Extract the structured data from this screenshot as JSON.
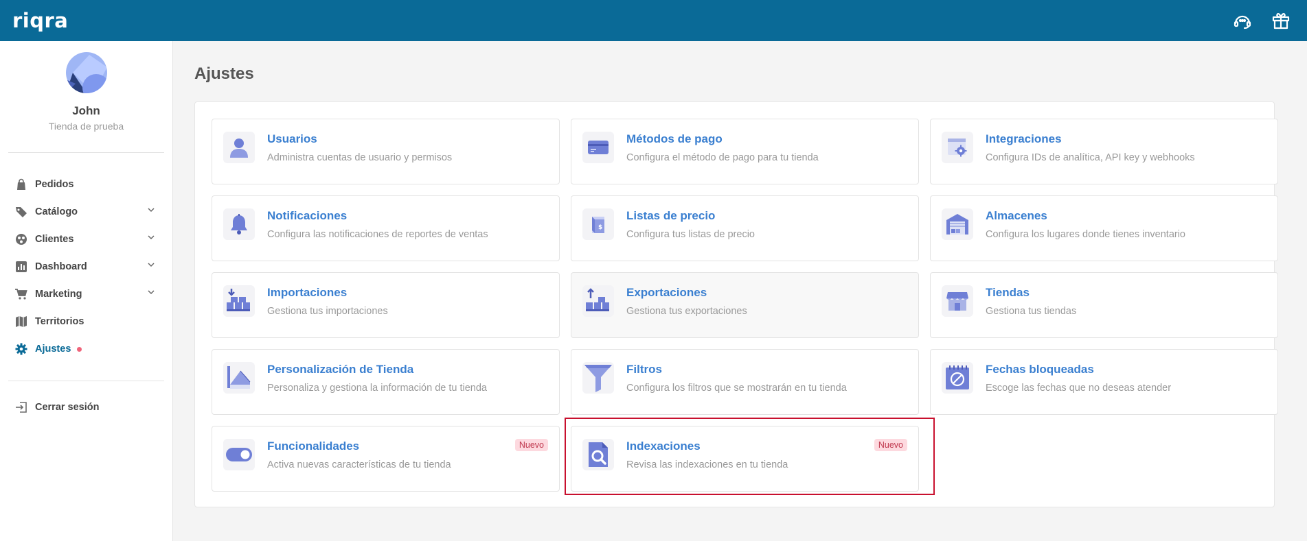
{
  "header": {
    "logo": "riqra",
    "icons": [
      "support-icon",
      "gift-icon"
    ]
  },
  "profile": {
    "name": "John",
    "store": "Tienda de prueba"
  },
  "nav": {
    "items": [
      {
        "label": "Pedidos",
        "icon": "bag-icon"
      },
      {
        "label": "Catálogo",
        "icon": "tag-icon"
      },
      {
        "label": "Clientes",
        "icon": "users-icon"
      },
      {
        "label": "Dashboard",
        "icon": "chart-icon"
      },
      {
        "label": "Marketing",
        "icon": "cart-icon"
      },
      {
        "label": "Territorios",
        "icon": "map-icon"
      },
      {
        "label": "Ajustes",
        "icon": "gear-icon"
      }
    ],
    "logout": "Cerrar sesión"
  },
  "page": {
    "title": "Ajustes"
  },
  "cards": [
    {
      "title": "Usuarios",
      "desc": "Administra cuentas de usuario y permisos",
      "icon": "user-icon"
    },
    {
      "title": "Métodos de pago",
      "desc": "Configura el método de pago para tu tienda",
      "icon": "credit-card-icon"
    },
    {
      "title": "Integraciones",
      "desc": "Configura IDs de analítica, API key y webhooks",
      "icon": "integration-gear-icon"
    },
    {
      "title": "Notificaciones",
      "desc": "Configura las notificaciones de reportes de ventas",
      "icon": "bell-icon"
    },
    {
      "title": "Listas de precio",
      "desc": "Configura tus listas de precio",
      "icon": "price-list-icon"
    },
    {
      "title": "Almacenes",
      "desc": "Configura los lugares donde tienes inventario",
      "icon": "warehouse-icon"
    },
    {
      "title": "Importaciones",
      "desc": "Gestiona tus importaciones",
      "icon": "import-icon"
    },
    {
      "title": "Exportaciones",
      "desc": "Gestiona tus exportaciones",
      "icon": "export-icon"
    },
    {
      "title": "Tiendas",
      "desc": "Gestiona tus tiendas",
      "icon": "store-icon"
    },
    {
      "title": "Personalización de Tienda",
      "desc": "Personaliza y gestiona la información de tu tienda",
      "icon": "customize-icon"
    },
    {
      "title": "Filtros",
      "desc": "Configura los filtros que se mostrarán en tu tienda",
      "icon": "funnel-icon"
    },
    {
      "title": "Fechas bloqueadas",
      "desc": "Escoge las fechas que no deseas atender",
      "icon": "blocked-calendar-icon"
    },
    {
      "title": "Funcionalidades",
      "desc": "Activa nuevas características de tu tienda",
      "icon": "toggle-icon",
      "badge": "Nuevo"
    },
    {
      "title": "Indexaciones",
      "desc": "Revisa las indexaciones en tu tienda",
      "icon": "search-document-icon",
      "badge": "Nuevo"
    }
  ],
  "colors": {
    "header": "#0a6a97",
    "link": "#3a7fd0",
    "icon": "#6f7fd6",
    "badge_bg": "#fdd9df",
    "highlight": "#c8102e"
  }
}
